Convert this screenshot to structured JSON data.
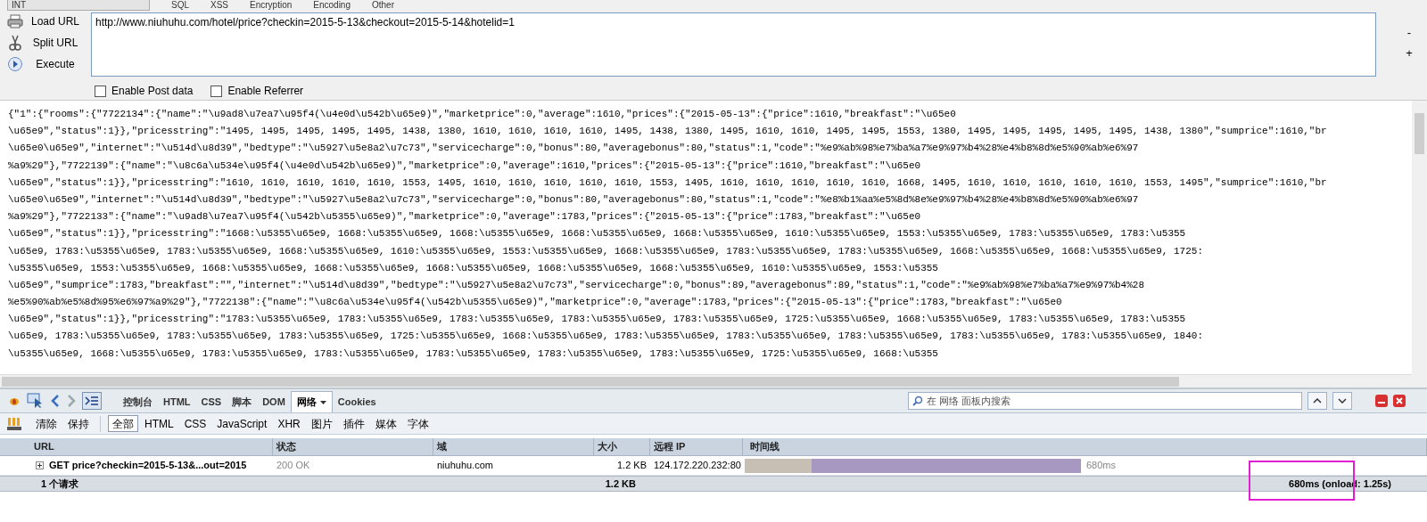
{
  "top_menu": {
    "dropdown": "INT",
    "items": [
      "SQL",
      "XSS",
      "Encryption",
      "Encoding",
      "Other"
    ]
  },
  "hackbar": {
    "actions": [
      {
        "label": "Load URL",
        "kind": "load"
      },
      {
        "label": "Split URL",
        "kind": "split"
      },
      {
        "label": "Execute",
        "kind": "execute"
      }
    ],
    "url": "http://www.niuhuhu.com/hotel/price?checkin=2015-5-13&checkout=2015-5-14&hotelid=1",
    "side_buttons": [
      "-",
      "+"
    ],
    "options": [
      {
        "label": "Enable Post data",
        "checked": false
      },
      {
        "label": "Enable Referrer",
        "checked": false
      }
    ]
  },
  "response_lines": [
    "{\"1\":{\"rooms\":{\"7722134\":{\"name\":\"\\u9ad8\\u7ea7\\u95f4(\\u4e0d\\u542b\\u65e9)\",\"marketprice\":0,\"average\":1610,\"prices\":{\"2015-05-13\":{\"price\":1610,\"breakfast\":\"\\u65e0",
    "\\u65e9\",\"status\":1}},\"pricesstring\":\"1495, 1495, 1495, 1495, 1495, 1438, 1380, 1610, 1610, 1610, 1610, 1495, 1438, 1380, 1495, 1610, 1610, 1495, 1495, 1553, 1380, 1495, 1495, 1495, 1495, 1495, 1438, 1380\",\"sumprice\":1610,\"br",
    "\\u65e0\\u65e9\",\"internet\":\"\\u514d\\u8d39\",\"bedtype\":\"\\u5927\\u5e8a2\\u7c73\",\"servicecharge\":0,\"bonus\":80,\"averagebonus\":80,\"status\":1,\"code\":\"%e9%ab%98%e7%ba%a7%e9%97%b4%28%e4%b8%8d%e5%90%ab%e6%97",
    "%a9%29\"},\"7722139\":{\"name\":\"\\u8c6a\\u534e\\u95f4(\\u4e0d\\u542b\\u65e9)\",\"marketprice\":0,\"average\":1610,\"prices\":{\"2015-05-13\":{\"price\":1610,\"breakfast\":\"\\u65e0",
    "\\u65e9\",\"status\":1}},\"pricesstring\":\"1610, 1610, 1610, 1610, 1610, 1553, 1495, 1610, 1610, 1610, 1610, 1610, 1553, 1495, 1610, 1610, 1610, 1610, 1610, 1668, 1495, 1610, 1610, 1610, 1610, 1610, 1553, 1495\",\"sumprice\":1610,\"br",
    "\\u65e0\\u65e9\",\"internet\":\"\\u514d\\u8d39\",\"bedtype\":\"\\u5927\\u5e8a2\\u7c73\",\"servicecharge\":0,\"bonus\":80,\"averagebonus\":80,\"status\":1,\"code\":\"%e8%b1%aa%e5%8d%8e%e9%97%b4%28%e4%b8%8d%e5%90%ab%e6%97",
    "%a9%29\"},\"7722133\":{\"name\":\"\\u9ad8\\u7ea7\\u95f4(\\u542b\\u5355\\u65e9)\",\"marketprice\":0,\"average\":1783,\"prices\":{\"2015-05-13\":{\"price\":1783,\"breakfast\":\"\\u65e0",
    "\\u65e9\",\"status\":1}},\"pricesstring\":\"1668:\\u5355\\u65e9, 1668:\\u5355\\u65e9, 1668:\\u5355\\u65e9, 1668:\\u5355\\u65e9, 1668:\\u5355\\u65e9, 1610:\\u5355\\u65e9, 1553:\\u5355\\u65e9, 1783:\\u5355\\u65e9, 1783:\\u5355",
    "\\u65e9, 1783:\\u5355\\u65e9, 1783:\\u5355\\u65e9, 1668:\\u5355\\u65e9, 1610:\\u5355\\u65e9, 1553:\\u5355\\u65e9, 1668:\\u5355\\u65e9, 1783:\\u5355\\u65e9, 1783:\\u5355\\u65e9, 1668:\\u5355\\u65e9, 1668:\\u5355\\u65e9, 1725:",
    "\\u5355\\u65e9, 1553:\\u5355\\u65e9, 1668:\\u5355\\u65e9, 1668:\\u5355\\u65e9, 1668:\\u5355\\u65e9, 1668:\\u5355\\u65e9, 1668:\\u5355\\u65e9, 1610:\\u5355\\u65e9, 1553:\\u5355",
    "\\u65e9\",\"sumprice\":1783,\"breakfast\":\"\",\"internet\":\"\\u514d\\u8d39\",\"bedtype\":\"\\u5927\\u5e8a2\\u7c73\",\"servicecharge\":0,\"bonus\":89,\"averagebonus\":89,\"status\":1,\"code\":\"%e9%ab%98%e7%ba%a7%e9%97%b4%28",
    "%e5%90%ab%e5%8d%95%e6%97%a9%29\"},\"7722138\":{\"name\":\"\\u8c6a\\u534e\\u95f4(\\u542b\\u5355\\u65e9)\",\"marketprice\":0,\"average\":1783,\"prices\":{\"2015-05-13\":{\"price\":1783,\"breakfast\":\"\\u65e0",
    "\\u65e9\",\"status\":1}},\"pricesstring\":\"1783:\\u5355\\u65e9, 1783:\\u5355\\u65e9, 1783:\\u5355\\u65e9, 1783:\\u5355\\u65e9, 1783:\\u5355\\u65e9, 1725:\\u5355\\u65e9, 1668:\\u5355\\u65e9, 1783:\\u5355\\u65e9, 1783:\\u5355",
    "\\u65e9, 1783:\\u5355\\u65e9, 1783:\\u5355\\u65e9, 1783:\\u5355\\u65e9, 1725:\\u5355\\u65e9, 1668:\\u5355\\u65e9, 1783:\\u5355\\u65e9, 1783:\\u5355\\u65e9, 1783:\\u5355\\u65e9, 1783:\\u5355\\u65e9, 1783:\\u5355\\u65e9, 1840:",
    "\\u5355\\u65e9, 1668:\\u5355\\u65e9, 1783:\\u5355\\u65e9, 1783:\\u5355\\u65e9, 1783:\\u5355\\u65e9, 1783:\\u5355\\u65e9, 1783:\\u5355\\u65e9, 1725:\\u5355\\u65e9, 1668:\\u5355"
  ],
  "devtools": {
    "tabs": [
      {
        "label": "控制台",
        "selected": false,
        "dropdown": false
      },
      {
        "label": "HTML",
        "selected": false,
        "dropdown": false
      },
      {
        "label": "CSS",
        "selected": false,
        "dropdown": false
      },
      {
        "label": "脚本",
        "selected": false,
        "dropdown": false
      },
      {
        "label": "DOM",
        "selected": false,
        "dropdown": false
      },
      {
        "label": "网络",
        "selected": true,
        "dropdown": true
      },
      {
        "label": "Cookies",
        "selected": false,
        "dropdown": false
      }
    ],
    "search": {
      "placeholder": "在 网络 面板内搜索"
    },
    "net_actions": [
      "清除",
      "保持"
    ],
    "filters": [
      {
        "label": "全部",
        "selected": true
      },
      {
        "label": "HTML",
        "selected": false
      },
      {
        "label": "CSS",
        "selected": false
      },
      {
        "label": "JavaScript",
        "selected": false
      },
      {
        "label": "XHR",
        "selected": false
      },
      {
        "label": "图片",
        "selected": false
      },
      {
        "label": "插件",
        "selected": false
      },
      {
        "label": "媒体",
        "selected": false
      },
      {
        "label": "字体",
        "selected": false
      }
    ],
    "table": {
      "columns": [
        "URL",
        "状态",
        "域",
        "大小",
        "远程 IP",
        "时间线"
      ],
      "rows": [
        {
          "request": "GET price?checkin=2015-5-13&...out=2015",
          "status": "200 OK",
          "domain": "niuhuhu.com",
          "size": "1.2 KB",
          "remote_ip": "124.172.220.232:80",
          "time": "680ms"
        }
      ],
      "summary": {
        "count": "1 个请求",
        "size": "1.2 KB",
        "timing": "680ms (onload: 1.25s)"
      }
    }
  }
}
